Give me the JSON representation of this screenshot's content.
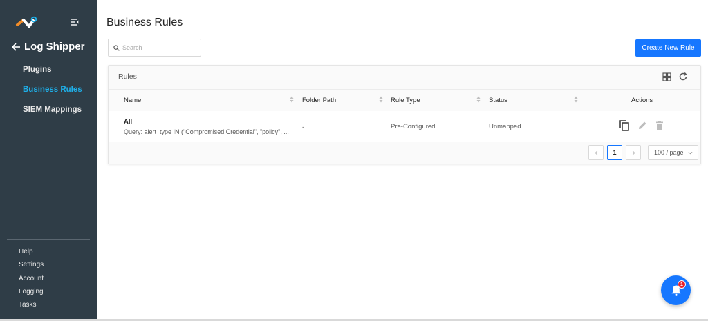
{
  "sidebar": {
    "back_label": "Log Shipper",
    "items": [
      {
        "label": "Plugins",
        "active": false
      },
      {
        "label": "Business Rules",
        "active": true
      },
      {
        "label": "SIEM Mappings",
        "active": false
      }
    ],
    "bottom_items": [
      "Help",
      "Settings",
      "Account",
      "Logging",
      "Tasks"
    ]
  },
  "header": {
    "title": "Business Rules",
    "create_label": "Create New Rule"
  },
  "search": {
    "placeholder": "Search",
    "value": ""
  },
  "card": {
    "title": "Rules"
  },
  "table": {
    "columns": [
      "Name",
      "Folder Path",
      "Rule Type",
      "Status",
      "Actions"
    ],
    "rows": [
      {
        "name": "All",
        "query": "Query: alert_type IN (\"Compromised Credential\", \"policy\", ...",
        "folder_path": "-",
        "rule_type": "Pre-Configured",
        "status": "Unmapped"
      }
    ]
  },
  "pagination": {
    "prev": "<",
    "current_page": "1",
    "next": ">",
    "page_size": "100 / page"
  },
  "notification": {
    "count": "1"
  },
  "colors": {
    "sidebar_bg": "#2f3d47",
    "accent": "#1677ff",
    "active_nav": "#1eb0ea",
    "badge": "#e8202a"
  },
  "icons": [
    "logo-icon",
    "collapse-menu-icon",
    "arrow-left-icon",
    "search-icon",
    "grid-icon",
    "reload-icon",
    "sort-icon",
    "copy-icon",
    "edit-icon",
    "delete-icon",
    "chevron-left-icon",
    "chevron-right-icon",
    "chevron-down-icon",
    "bell-icon"
  ]
}
